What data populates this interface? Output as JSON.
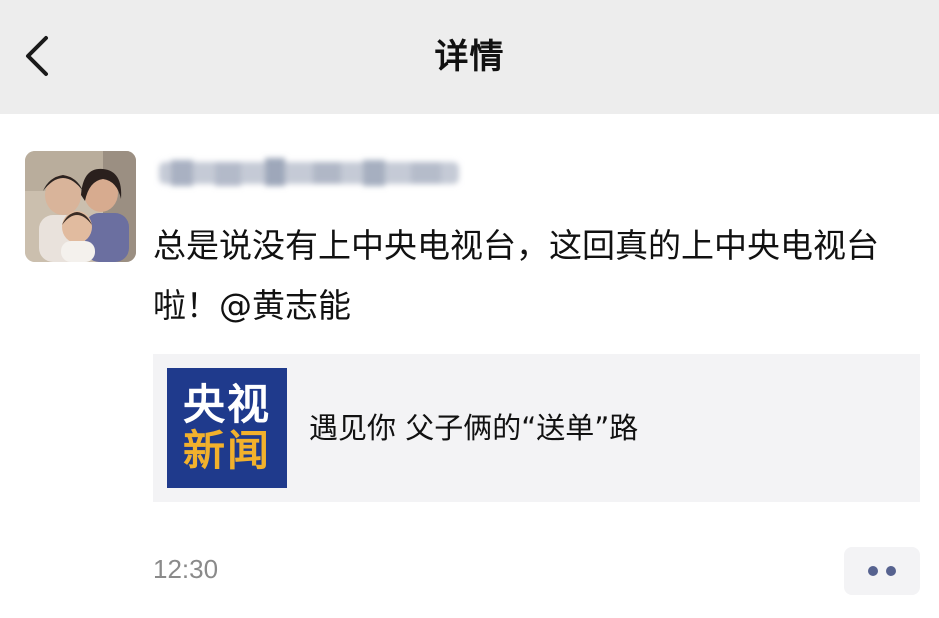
{
  "header": {
    "title": "详情",
    "back_icon": "chevron-left-icon"
  },
  "post": {
    "text": "总是说没有上中央电视台，这回真的上中央电视台啦！@黄志能",
    "time": "12:30",
    "more_icon": "more-dots-icon"
  },
  "shared_card": {
    "thumb_line1": "央视",
    "thumb_line2": "新闻",
    "title": "遇见你 父子俩的“送单”路"
  },
  "colors": {
    "nav_bg": "#ededed",
    "card_bg": "#f3f3f5",
    "thumb_bg": "#1f3a8c",
    "thumb_accent": "#f2b12c",
    "dot_color": "#56628f",
    "time_color": "#8a8a8a"
  }
}
